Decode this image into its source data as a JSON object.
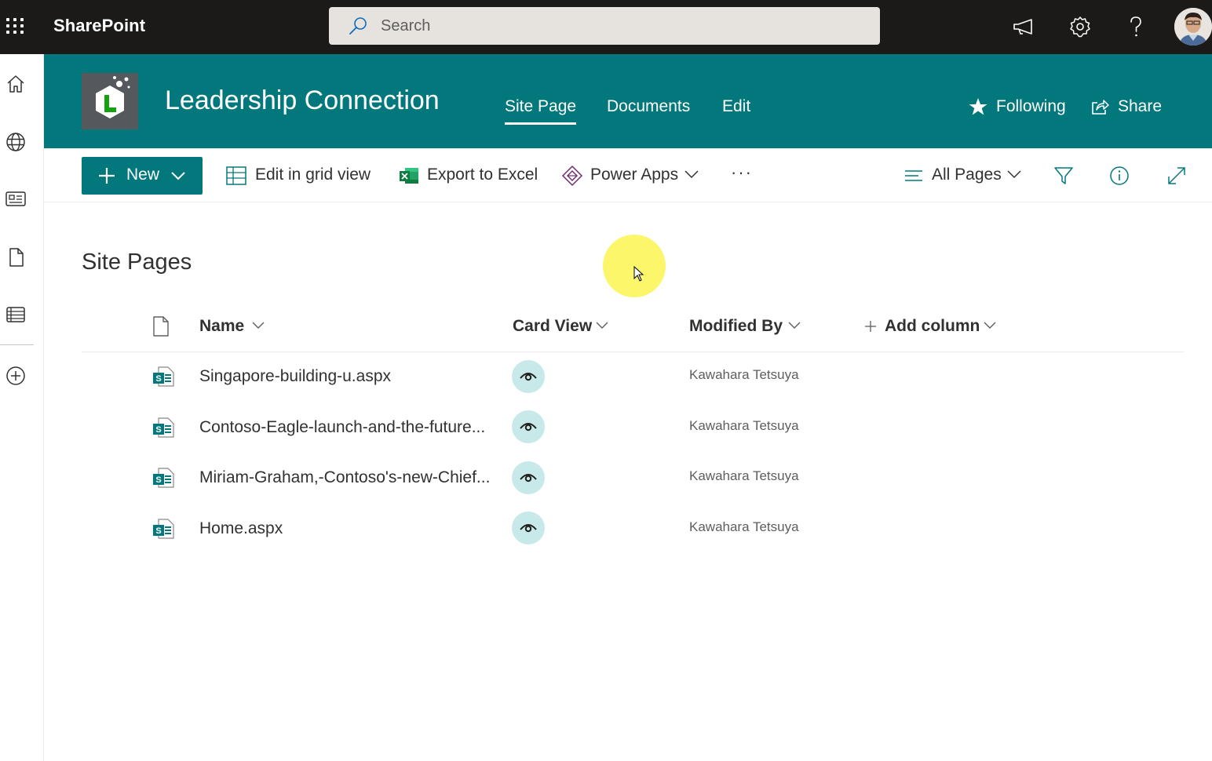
{
  "suite_bar": {
    "app_name": "SharePoint",
    "search_placeholder": "Search",
    "icons": [
      "waffle-icon",
      "megaphone-icon",
      "gear-icon",
      "help-icon",
      "avatar"
    ]
  },
  "left_rail": {
    "items": [
      "home-icon",
      "globe-icon",
      "news-icon",
      "file-icon",
      "list-icon",
      "create-icon"
    ]
  },
  "site_header": {
    "title": "Leadership Connection",
    "logo_letter": "L",
    "nav": [
      {
        "label": "Site Page",
        "active": true
      },
      {
        "label": "Documents",
        "active": false
      },
      {
        "label": "Edit",
        "active": false
      }
    ],
    "following_label": "Following",
    "share_label": "Share",
    "theme_color": "#03787c"
  },
  "command_bar": {
    "new_label": "New",
    "edit_grid_label": "Edit in grid view",
    "export_label": "Export to Excel",
    "power_apps_label": "Power Apps",
    "more_label": "···",
    "view_label": "All Pages"
  },
  "library": {
    "title": "Site Pages",
    "columns": {
      "name": "Name",
      "card_view": "Card View",
      "modified_by": "Modified By",
      "add_column": "Add column"
    },
    "rows": [
      {
        "name": "Singapore-building-u.aspx",
        "modified_by": "Kawahara Tetsuya"
      },
      {
        "name": "Contoso-Eagle-launch-and-the-future...",
        "modified_by": "Kawahara Tetsuya"
      },
      {
        "name": "Miriam-Graham,-Contoso's-new-Chief...",
        "modified_by": "Kawahara Tetsuya"
      },
      {
        "name": "Home.aspx",
        "modified_by": "Kawahara Tetsuya"
      }
    ]
  }
}
